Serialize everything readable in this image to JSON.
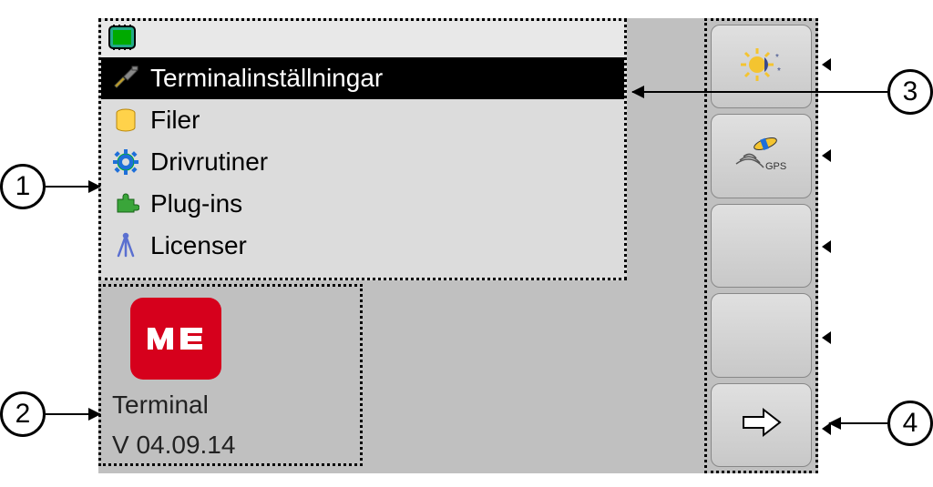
{
  "menu": {
    "items": [
      {
        "label": "Terminalinställningar",
        "icon": "tools-icon",
        "selected": true
      },
      {
        "label": "Filer",
        "icon": "database-icon",
        "selected": false
      },
      {
        "label": "Drivrutiner",
        "icon": "gear-icon",
        "selected": false
      },
      {
        "label": "Plug-ins",
        "icon": "puzzle-icon",
        "selected": false
      },
      {
        "label": "Licenser",
        "icon": "licenses-icon",
        "selected": false
      }
    ]
  },
  "info": {
    "name": "Terminal",
    "version": "V 04.09.14",
    "logo_text": "ME"
  },
  "softkeys": [
    {
      "name": "brightness-button",
      "icon": "sun-icon"
    },
    {
      "name": "gps-button",
      "icon": "gps-icon",
      "label": "GPS"
    },
    {
      "name": "blank-button-1",
      "icon": ""
    },
    {
      "name": "blank-button-2",
      "icon": ""
    },
    {
      "name": "next-button",
      "icon": "arrow-right-icon"
    }
  ],
  "callouts": {
    "c1": "1",
    "c2": "2",
    "c3": "3",
    "c4": "4"
  }
}
